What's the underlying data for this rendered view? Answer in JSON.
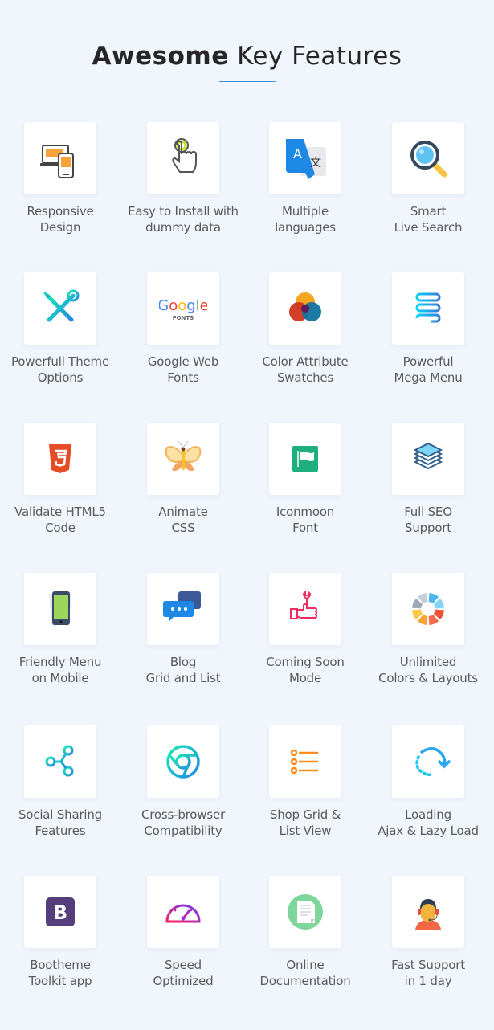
{
  "header": {
    "title_bold": "Awesome",
    "title_light": "Key Features",
    "accent_color": "#4a8ecf"
  },
  "features": [
    {
      "lines": [
        "Responsive",
        "Design"
      ],
      "icon": "responsive-devices-icon"
    },
    {
      "lines": [
        "Easy to Install with",
        "dummy data"
      ],
      "icon": "tap-hand-icon"
    },
    {
      "lines": [
        "Multiple",
        "languages"
      ],
      "icon": "translate-icon"
    },
    {
      "lines": [
        "Smart",
        "Live Search"
      ],
      "icon": "magnifier-icon"
    },
    {
      "lines": [
        "Powerfull Theme",
        "Options"
      ],
      "icon": "tools-icon"
    },
    {
      "lines": [
        "Google Web",
        "Fonts"
      ],
      "icon": "google-fonts-icon",
      "icon_text": {
        "brand": "Google",
        "sub": "FONTS"
      }
    },
    {
      "lines": [
        "Color Attribute",
        "Swatches"
      ],
      "icon": "color-swatches-icon"
    },
    {
      "lines": [
        "Powerful",
        "Mega Menu"
      ],
      "icon": "mega-menu-icon"
    },
    {
      "lines": [
        "Validate HTML5",
        "Code"
      ],
      "icon": "html5-icon"
    },
    {
      "lines": [
        "Animate",
        "CSS"
      ],
      "icon": "butterfly-icon"
    },
    {
      "lines": [
        "Iconmoon",
        "Font"
      ],
      "icon": "flag-icon"
    },
    {
      "lines": [
        "Full SEO",
        "Support"
      ],
      "icon": "layers-icon"
    },
    {
      "lines": [
        "Friendly Menu",
        "on Mobile"
      ],
      "icon": "mobile-phone-icon"
    },
    {
      "lines": [
        "Blog",
        "Grid and List"
      ],
      "icon": "chat-bubbles-icon"
    },
    {
      "lines": [
        "Coming Soon",
        "Mode"
      ],
      "icon": "wrench-hand-icon"
    },
    {
      "lines": [
        "Unlimited",
        "Colors & Layouts"
      ],
      "icon": "color-wheel-icon"
    },
    {
      "lines": [
        "Social Sharing",
        "Features"
      ],
      "icon": "share-icon"
    },
    {
      "lines": [
        "Cross-browser",
        "Compatibility"
      ],
      "icon": "chrome-browser-icon"
    },
    {
      "lines": [
        "Shop Grid &",
        "List View"
      ],
      "icon": "list-view-icon"
    },
    {
      "lines": [
        "Loading",
        "Ajax & Lazy Load"
      ],
      "icon": "loading-refresh-icon"
    },
    {
      "lines": [
        "Bootheme",
        "Toolkit app"
      ],
      "icon": "bootstrap-icon",
      "icon_text": {
        "brand": "B"
      }
    },
    {
      "lines": [
        "Speed",
        "Optimized"
      ],
      "icon": "speedometer-icon"
    },
    {
      "lines": [
        "Online",
        "Documentation"
      ],
      "icon": "document-icon"
    },
    {
      "lines": [
        "Fast Support",
        "in 1 day"
      ],
      "icon": "support-agent-icon"
    }
  ]
}
